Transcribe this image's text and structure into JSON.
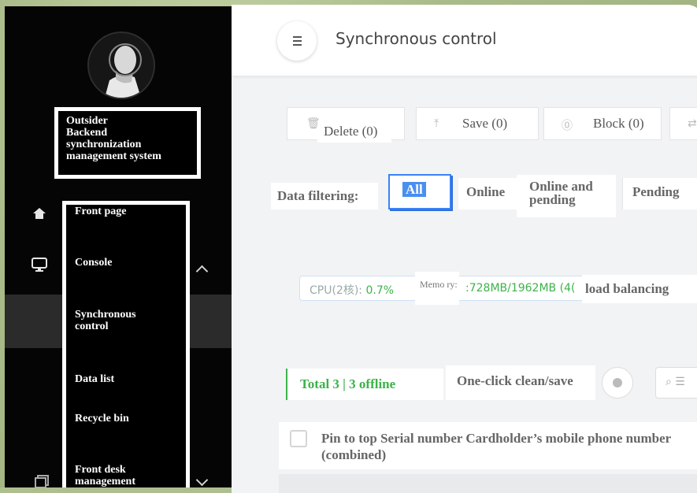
{
  "sidebar": {
    "brand_lines": [
      "Outsider",
      "Backend",
      "synchronization",
      "management system"
    ],
    "menu": [
      {
        "label": "Front page"
      },
      {
        "label": "Console"
      },
      {
        "label": "Synchronous control"
      },
      {
        "label": "Data list"
      },
      {
        "label": "Recycle bin"
      },
      {
        "label": "Front desk management"
      }
    ]
  },
  "header": {
    "title": "Synchronous control"
  },
  "toolbar": {
    "delete": "Delete (0)",
    "save": "Save (0)",
    "block": "Block (0)"
  },
  "filters": {
    "label": "Data filtering:",
    "options": [
      "All",
      "Online",
      "Online and pending",
      "Pending"
    ],
    "selected": "All"
  },
  "system": {
    "cpu_label": "CPU(2核):",
    "cpu_value": "0.7%",
    "memory_label": "Memo ry:",
    "memory_value": ":728MB/1962MB (4(",
    "load_balancing": "load balancing"
  },
  "summary": {
    "total": "Total 3 | 3 offline",
    "one_click": "One-click clean/save"
  },
  "table": {
    "header": "Pin to top   Serial number   Cardholder’s mobile phone number (combined)"
  },
  "colors": {
    "accent": "#3b82f6",
    "green": "#3cb34a",
    "sidebar": "#050505"
  }
}
